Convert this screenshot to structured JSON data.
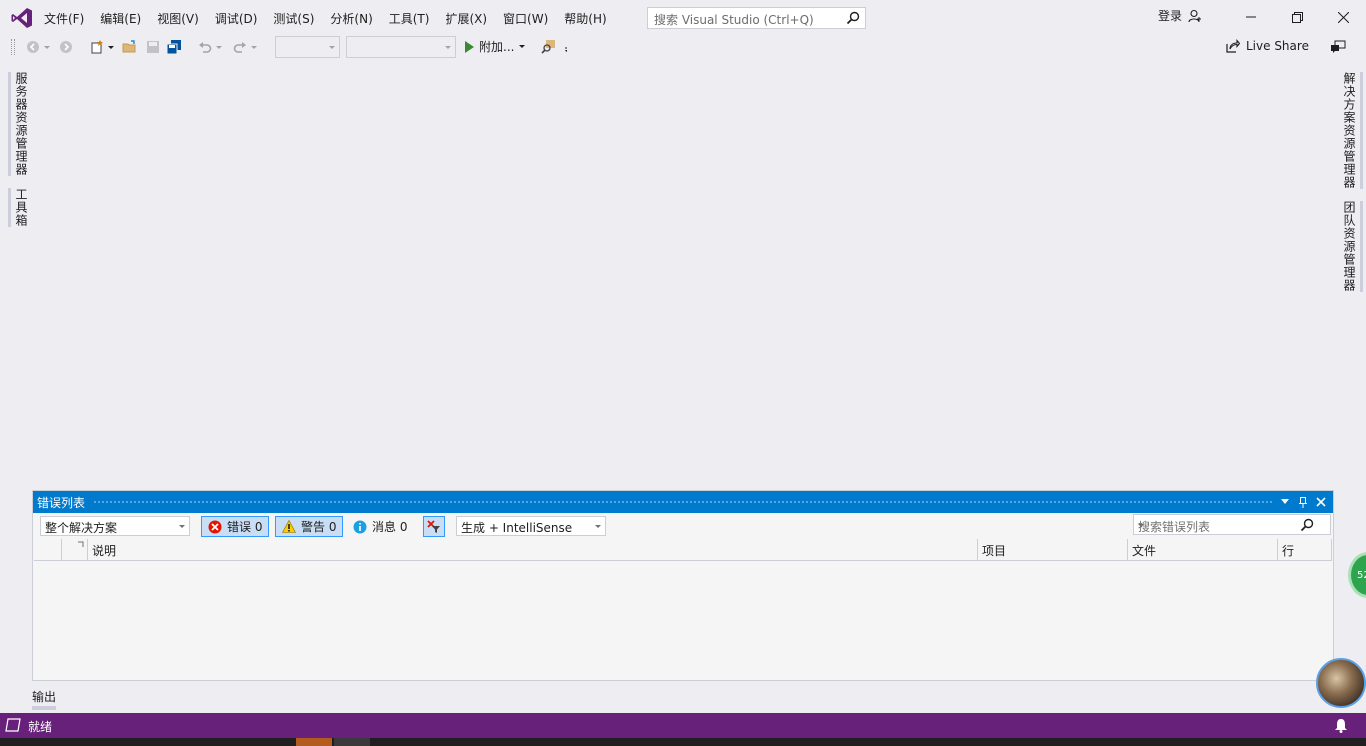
{
  "menu": {
    "items": [
      "文件(F)",
      "编辑(E)",
      "视图(V)",
      "调试(D)",
      "测试(S)",
      "分析(N)",
      "工具(T)",
      "扩展(X)",
      "窗口(W)",
      "帮助(H)"
    ]
  },
  "search": {
    "placeholder": "搜索 Visual Studio (Ctrl+Q)"
  },
  "account": {
    "login_label": "登录"
  },
  "toolbar": {
    "attach_label": "附加...",
    "live_share_label": "Live Share"
  },
  "side_left": {
    "tabs": [
      "服务器资源管理器",
      "工具箱"
    ]
  },
  "side_right": {
    "tabs": [
      "解决方案资源管理器",
      "团队资源管理器"
    ]
  },
  "error_list": {
    "title": "错误列表",
    "scope": "整个解决方案",
    "errors_label": "错误 0",
    "warnings_label": "警告 0",
    "messages_label": "消息 0",
    "build_filter": "生成 + IntelliSense",
    "search_placeholder": "搜索错误列表",
    "columns": {
      "description": "说明",
      "project": "项目",
      "file": "文件",
      "line": "行"
    }
  },
  "output": {
    "tab_label": "输出"
  },
  "status": {
    "text": "就绪"
  },
  "overlay": {
    "badge_text": "52"
  },
  "colors": {
    "accent": "#007acc",
    "statusbar": "#68217a",
    "brand": "#68217a"
  }
}
